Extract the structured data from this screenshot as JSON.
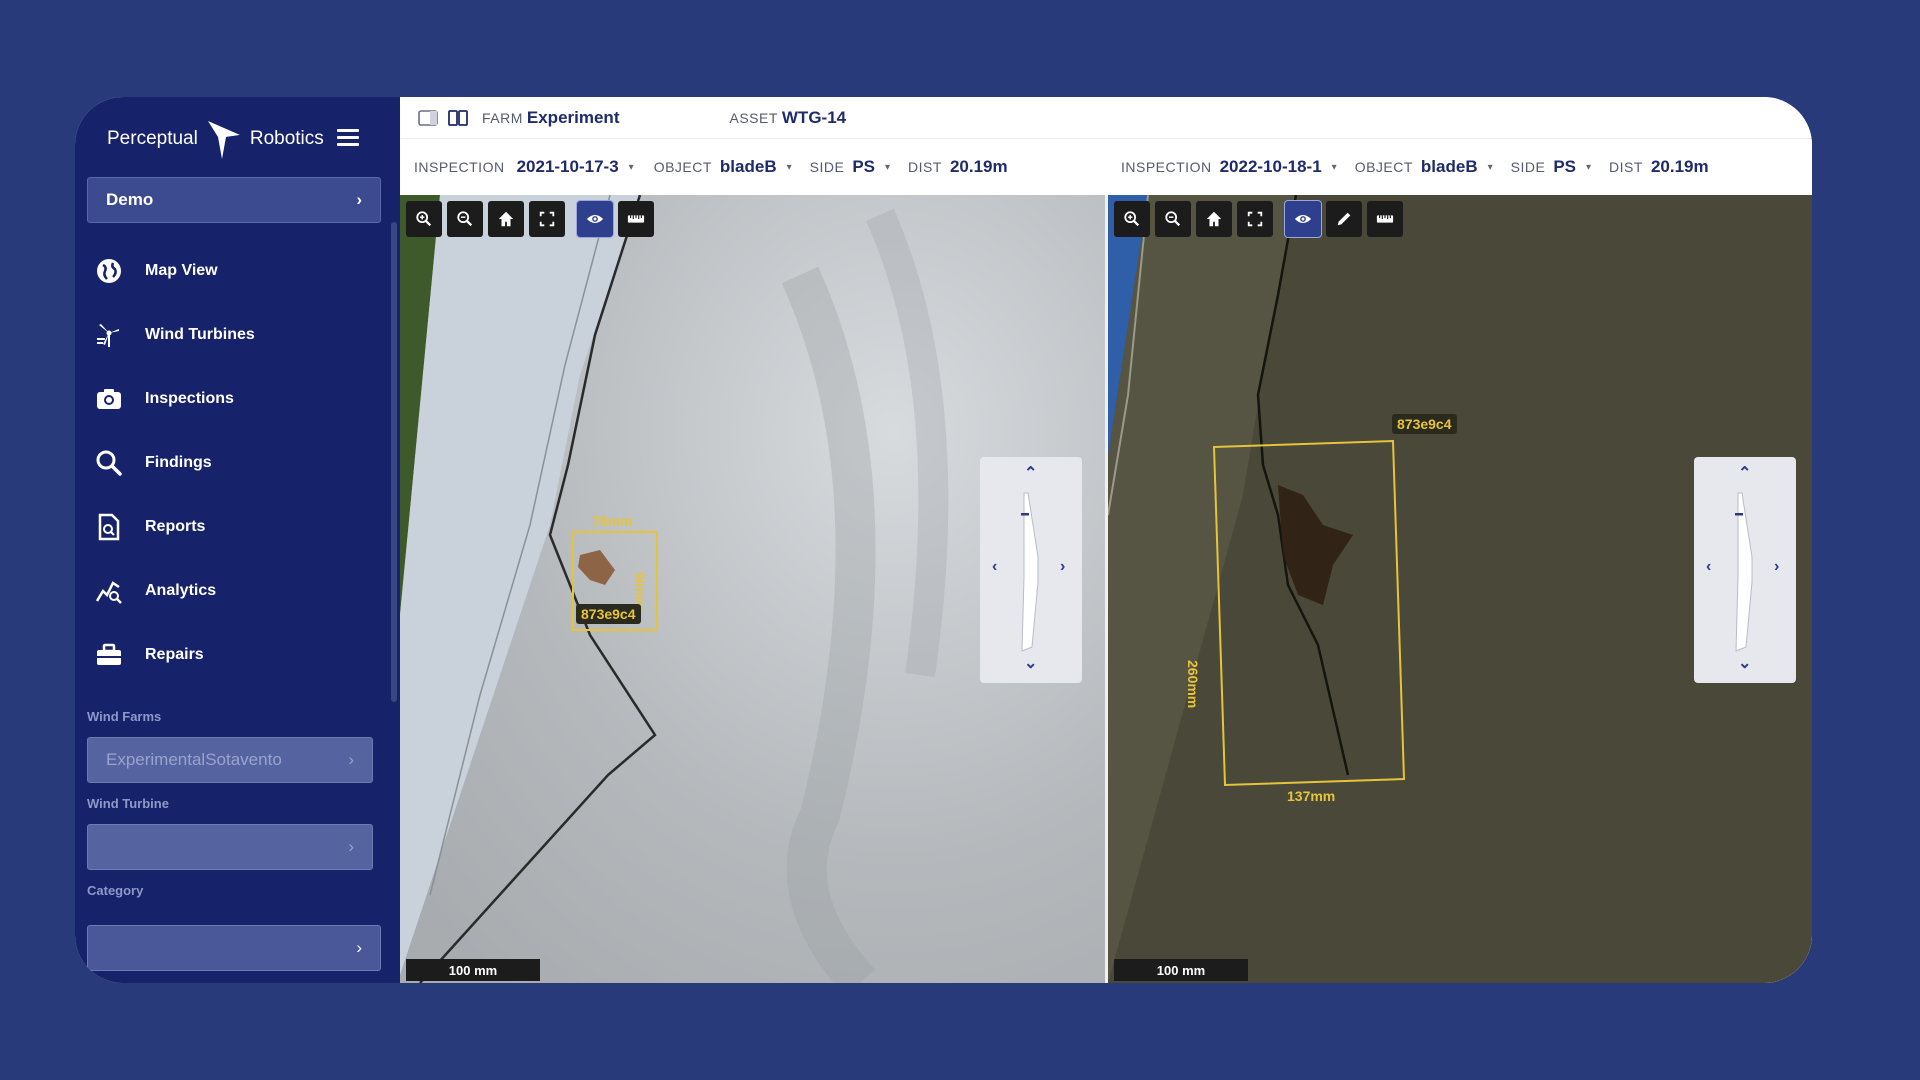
{
  "brand": {
    "left": "Perceptual",
    "right": "Robotics"
  },
  "sidebar": {
    "demo_label": "Demo",
    "items": [
      {
        "label": "Map View",
        "icon": "globe-icon"
      },
      {
        "label": "Wind Turbines",
        "icon": "wind-turbine-icon"
      },
      {
        "label": "Inspections",
        "icon": "camera-icon"
      },
      {
        "label": "Findings",
        "icon": "search-icon"
      },
      {
        "label": "Reports",
        "icon": "report-icon"
      },
      {
        "label": "Analytics",
        "icon": "analytics-icon"
      },
      {
        "label": "Repairs",
        "icon": "toolbox-icon"
      }
    ],
    "wind_farms_label": "Wind Farms",
    "wind_farm_value": "ExperimentalSotavento",
    "wind_turbine_label": "Wind Turbine",
    "wind_turbine_value": "",
    "category_label": "Category",
    "category_value": ""
  },
  "topbar": {
    "farm_label": "FARM",
    "farm_value": "Experiment",
    "asset_label": "ASSET",
    "asset_value": "WTG-14"
  },
  "left_panel": {
    "inspection_label": "INSPECTION",
    "inspection_value": "2021-10-17-3",
    "object_label": "OBJECT",
    "object_value": "bladeB",
    "side_label": "SIDE",
    "side_value": "PS",
    "dist_label": "DIST",
    "dist_value": "20.19m",
    "annotation_id": "873e9c4",
    "width": "78mm",
    "height": "90mm",
    "scale": "100 mm"
  },
  "right_panel": {
    "inspection_label": "INSPECTION",
    "inspection_value": "2022-10-18-1",
    "object_label": "OBJECT",
    "object_value": "bladeB",
    "side_label": "SIDE",
    "side_value": "PS",
    "dist_label": "DIST",
    "dist_value": "20.19m",
    "annotation_id": "873e9c4",
    "width": "137mm",
    "height": "260mm",
    "scale": "100 mm"
  },
  "colors": {
    "background": "#283a7a",
    "sidebar": "#16226a",
    "accent": "#e6c43a"
  }
}
